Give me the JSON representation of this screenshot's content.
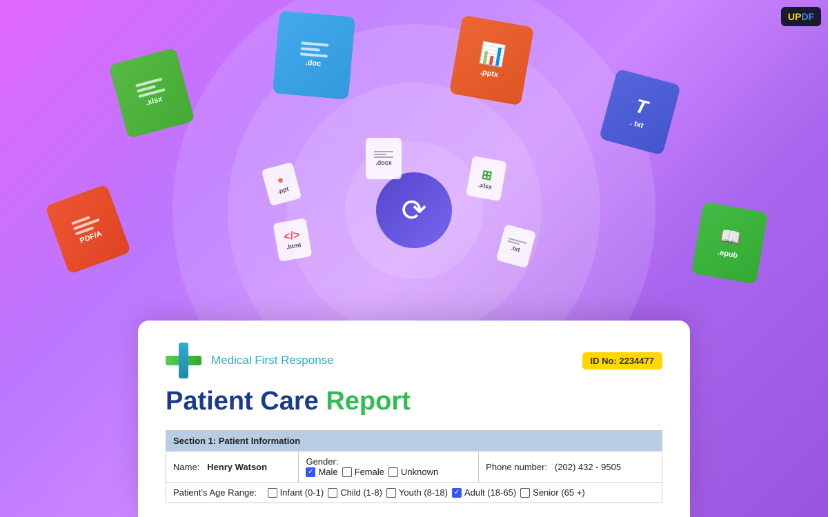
{
  "app": {
    "name": "UPDF",
    "logo_up": "UP",
    "logo_df": "DF"
  },
  "file_icons": {
    "large": [
      {
        "id": "xlsx-large",
        "ext": ".xlsx",
        "color": "green"
      },
      {
        "id": "doc-large",
        "ext": ".doc",
        "color": "blue"
      },
      {
        "id": "pptx-large",
        "ext": ".pptx",
        "color": "orange"
      },
      {
        "id": "txt-large",
        "ext": ".txt",
        "color": "indigo"
      },
      {
        "id": "pdfa-large",
        "ext": "PDF/A",
        "color": "red"
      },
      {
        "id": "epub-large",
        "ext": ".epub",
        "color": "green"
      }
    ],
    "small": [
      {
        "id": "docx-small",
        "ext": ".docx"
      },
      {
        "id": "xlsx-small",
        "ext": ".xlsx"
      },
      {
        "id": "html-small",
        "ext": ".html"
      },
      {
        "id": "ppt-small",
        "ext": ".ppt"
      },
      {
        "id": "txt-small",
        "ext": ".txt"
      }
    ]
  },
  "sync_button": {
    "icon": "↻",
    "aria": "Convert/Sync"
  },
  "document": {
    "org_name": "Medical First Response",
    "id_label": "ID No: 2234477",
    "title_part1": "Patient Care",
    "title_part2": "Report",
    "section1": {
      "header": "Section 1: Patient Information",
      "name_label": "Name:",
      "name_value": "Henry Watson",
      "gender_label": "Gender:",
      "gender_options": [
        {
          "label": "Male",
          "checked": true
        },
        {
          "label": "Female",
          "checked": false
        },
        {
          "label": "Unknown",
          "checked": false
        }
      ],
      "phone_label": "Phone number:",
      "phone_value": "(202) 432 - 9505",
      "age_range_label": "Patient's Age Range:",
      "age_options": [
        {
          "label": "Infant (0-1)",
          "checked": false
        },
        {
          "label": "Child (1-8)",
          "checked": false
        },
        {
          "label": "Youth (8-18)",
          "checked": false
        },
        {
          "label": "Adult (18-65)",
          "checked": true
        },
        {
          "label": "Senior (65 +)",
          "checked": false
        }
      ]
    }
  }
}
